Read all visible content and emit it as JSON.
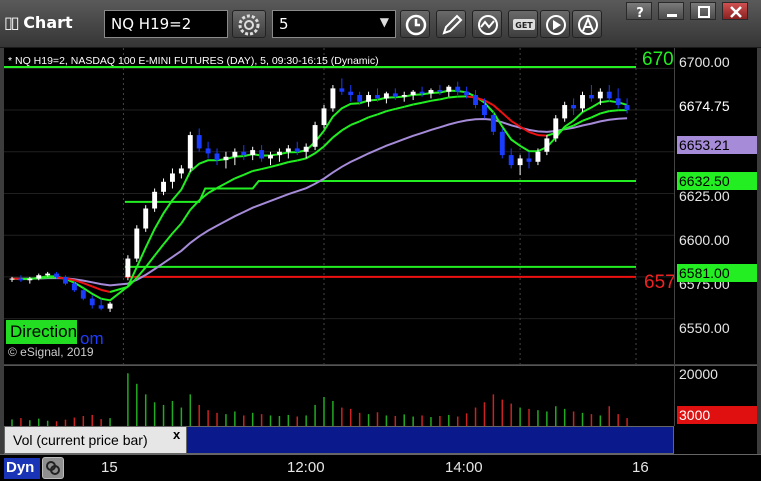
{
  "window": {
    "title": "Chart",
    "symbol": "NQ H19=2",
    "interval": "5"
  },
  "chart": {
    "subtitle": "* NQ H19=2, NASDAQ 100 E-MINI FUTURES (DAY), 5, 09:30-16:15 (Dynamic)",
    "brand_box": "DirectionT",
    "brand_suffix": "om",
    "copyright": "© eSignal, 2019",
    "right_label_green": "670",
    "right_label_red": "657"
  },
  "price_axis": {
    "labels": [
      "6700.00",
      "6625.00",
      "6600.00",
      "6575.00",
      "6550.00"
    ],
    "markers": [
      {
        "label": "6674.75",
        "color": "#000000",
        "text_color": "#ffffff"
      },
      {
        "label": "6653.21",
        "color": "#a58bd8",
        "text_color": "#000000"
      },
      {
        "label": "6632.50",
        "color": "#22ee22",
        "text_color": "#000000"
      },
      {
        "label": "6581.00",
        "color": "#22ee22",
        "text_color": "#000000"
      }
    ]
  },
  "volume": {
    "labels": [
      "20000"
    ],
    "marker": "3000",
    "marker_color": "#e01010",
    "study_label": "Vol (current price bar)",
    "close_glyph": "x"
  },
  "time_axis": {
    "labels": [
      "15",
      "12:00",
      "14:00",
      "16"
    ],
    "dyn_label": "Dyn"
  },
  "colors": {
    "up_candle": "#ffffff",
    "down_candle": "#1a3cff",
    "ma_fast": "#22ee22",
    "ma_slow_up": "#22ee22",
    "ma_slow_down": "#ee1111",
    "vwap": "#a58bd8",
    "level_green": "#22ee22",
    "level_red": "#ee1111",
    "vol_up": "#22aa22",
    "vol_down": "#cc2222"
  },
  "chart_data": {
    "type": "candlestick",
    "symbol": "NQ H19=2",
    "levels": [
      {
        "value": 6700.8,
        "color": "green"
      },
      {
        "value": 6632.5,
        "color": "green"
      },
      {
        "value": 6581.0,
        "color": "green"
      },
      {
        "value": 6575.0,
        "color": "red"
      }
    ],
    "ylim": [
      6530,
      6705
    ],
    "candles": [
      [
        6574,
        6575,
        6572,
        6574
      ],
      [
        6574,
        6576,
        6572,
        6573
      ],
      [
        6573,
        6575,
        6571,
        6574
      ],
      [
        6574,
        6577,
        6573,
        6576
      ],
      [
        6576,
        6578,
        6575,
        6577
      ],
      [
        6577,
        6578,
        6574,
        6575
      ],
      [
        6575,
        6576,
        6570,
        6571
      ],
      [
        6571,
        6572,
        6566,
        6567
      ],
      [
        6567,
        6568,
        6561,
        6562
      ],
      [
        6562,
        6564,
        6556,
        6558
      ],
      [
        6558,
        6562,
        6555,
        6556
      ],
      [
        6556,
        6560,
        6554,
        6559
      ],
      [
        6575,
        6588,
        6573,
        6586
      ],
      [
        6586,
        6606,
        6584,
        6604
      ],
      [
        6604,
        6618,
        6602,
        6616
      ],
      [
        6616,
        6628,
        6614,
        6626
      ],
      [
        6626,
        6634,
        6624,
        6632
      ],
      [
        6632,
        6640,
        6628,
        6637
      ],
      [
        6637,
        6642,
        6634,
        6640
      ],
      [
        6640,
        6662,
        6638,
        6660
      ],
      [
        6660,
        6664,
        6650,
        6652
      ],
      [
        6652,
        6656,
        6646,
        6649
      ],
      [
        6649,
        6652,
        6642,
        6645
      ],
      [
        6645,
        6650,
        6640,
        6647
      ],
      [
        6647,
        6652,
        6642,
        6650
      ],
      [
        6650,
        6654,
        6645,
        6648
      ],
      [
        6648,
        6653,
        6645,
        6651
      ],
      [
        6651,
        6654,
        6644,
        6646
      ],
      [
        6646,
        6650,
        6642,
        6648
      ],
      [
        6648,
        6652,
        6644,
        6650
      ],
      [
        6650,
        6654,
        6646,
        6652
      ],
      [
        6652,
        6656,
        6648,
        6650
      ],
      [
        6650,
        6655,
        6646,
        6653
      ],
      [
        6653,
        6668,
        6651,
        6666
      ],
      [
        6666,
        6678,
        6664,
        6676
      ],
      [
        6676,
        6690,
        6674,
        6688
      ],
      [
        6688,
        6694,
        6684,
        6686
      ],
      [
        6686,
        6690,
        6680,
        6684
      ],
      [
        6684,
        6686,
        6678,
        6680
      ],
      [
        6680,
        6686,
        6677,
        6684
      ],
      [
        6684,
        6688,
        6680,
        6682
      ],
      [
        6682,
        6686,
        6679,
        6685
      ],
      [
        6685,
        6688,
        6681,
        6683
      ],
      [
        6683,
        6686,
        6680,
        6684
      ],
      [
        6684,
        6687,
        6681,
        6686
      ],
      [
        6686,
        6689,
        6683,
        6685
      ],
      [
        6685,
        6688,
        6682,
        6687
      ],
      [
        6687,
        6690,
        6684,
        6686
      ],
      [
        6686,
        6690,
        6683,
        6689
      ],
      [
        6689,
        6692,
        6684,
        6686
      ],
      [
        6686,
        6689,
        6682,
        6684
      ],
      [
        6684,
        6687,
        6676,
        6678
      ],
      [
        6678,
        6682,
        6670,
        6672
      ],
      [
        6672,
        6674,
        6660,
        6662
      ],
      [
        6662,
        6664,
        6646,
        6648
      ],
      [
        6648,
        6652,
        6640,
        6642
      ],
      [
        6642,
        6648,
        6636,
        6646
      ],
      [
        6646,
        6650,
        6640,
        6644
      ],
      [
        6644,
        6652,
        6642,
        6650
      ],
      [
        6650,
        6660,
        6648,
        6658
      ],
      [
        6658,
        6672,
        6656,
        6670
      ],
      [
        6670,
        6680,
        6668,
        6678
      ],
      [
        6678,
        6682,
        6672,
        6676
      ],
      [
        6676,
        6686,
        6674,
        6684
      ],
      [
        6684,
        6690,
        6680,
        6682
      ],
      [
        6682,
        6688,
        6678,
        6686
      ],
      [
        6686,
        6690,
        6680,
        6682
      ],
      [
        6682,
        6688,
        6676,
        6678
      ],
      [
        6678,
        6682,
        6673,
        6675
      ]
    ],
    "volume": [
      2500,
      3000,
      2200,
      2800,
      2000,
      1800,
      2400,
      3200,
      3800,
      4200,
      2600,
      3000,
      20000,
      16000,
      12000,
      9000,
      8000,
      9500,
      7000,
      12000,
      8000,
      6000,
      5000,
      4500,
      5500,
      4000,
      5000,
      4500,
      4000,
      3800,
      4200,
      3600,
      4000,
      8000,
      11000,
      9500,
      7000,
      6500,
      5000,
      4500,
      5200,
      4000,
      3800,
      4400,
      3600,
      4000,
      3400,
      3800,
      4200,
      3600,
      4800,
      7000,
      9000,
      12000,
      10000,
      8500,
      7000,
      6500,
      6000,
      5500,
      7500,
      6500,
      5500,
      5000,
      4500,
      4000,
      7500,
      4500,
      3000
    ]
  }
}
